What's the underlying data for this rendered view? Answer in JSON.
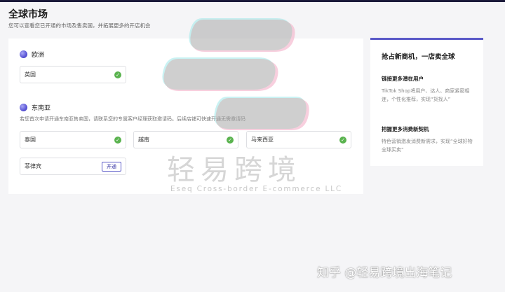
{
  "header": {
    "title": "全球市场",
    "subtitle": "您可以查看您已开通的市场及售卖国，并拓展更多的开店机会"
  },
  "regions": {
    "europe": {
      "name": "欧洲",
      "countries": [
        {
          "name": "英国",
          "status": "opened"
        }
      ]
    },
    "sea": {
      "name": "东南亚",
      "notice": "若您首次申请开通东南亚售卖国，请联系您的专属客户经理获取邀请码。后续店铺可快速开通无需邀请码",
      "countries": [
        {
          "name": "泰国",
          "status": "opened"
        },
        {
          "name": "越南",
          "status": "opened"
        },
        {
          "name": "马来西亚",
          "status": "opened"
        },
        {
          "name": "菲律宾",
          "status": "open",
          "button_label": "开通"
        }
      ]
    }
  },
  "promo": {
    "title": "抢占新商机，一店卖全球",
    "points": [
      {
        "heading": "链接更多潜在用户",
        "text": "TikTok Shop将用户、达人、商家紧密相连，个性化推荐，实现“货找人”"
      },
      {
        "heading": "把握更多消费新契机",
        "text": "特色营销激发消费新需求，实现“全球好物 全球买卖”"
      }
    ]
  },
  "watermark": {
    "text": "轻易跨境",
    "subtext": "Eseq Cross-border E-commerce LLC",
    "credit": "知乎 @轻易跨境出海笔记"
  },
  "colors": {
    "accent": "#5b5ac8",
    "success": "#5ab34f"
  }
}
